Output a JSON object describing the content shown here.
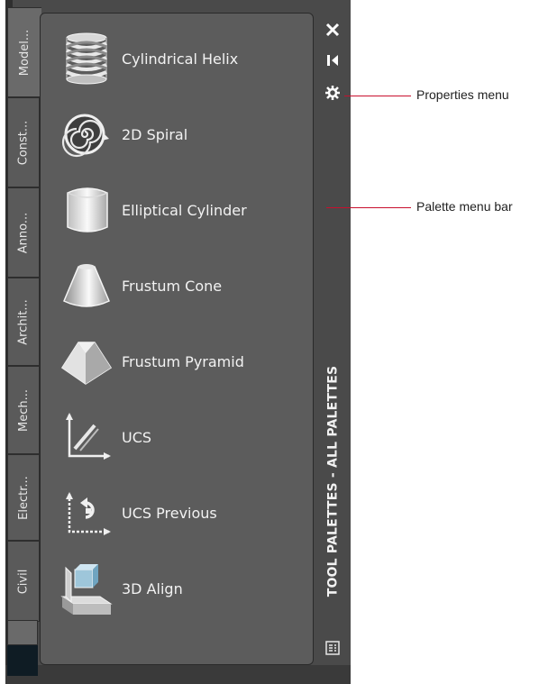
{
  "tabs": [
    {
      "label": "Model..."
    },
    {
      "label": "Const..."
    },
    {
      "label": "Anno..."
    },
    {
      "label": "Archit..."
    },
    {
      "label": "Mech..."
    },
    {
      "label": "Electr..."
    },
    {
      "label": "Civil"
    }
  ],
  "tools": [
    {
      "label": "Cylindrical Helix",
      "icon": "helix-icon"
    },
    {
      "label": "2D Spiral",
      "icon": "spiral-icon"
    },
    {
      "label": "Elliptical Cylinder",
      "icon": "cylinder-icon"
    },
    {
      "label": "Frustum Cone",
      "icon": "cone-icon"
    },
    {
      "label": "Frustum Pyramid",
      "icon": "pyramid-icon"
    },
    {
      "label": "UCS",
      "icon": "ucs-icon"
    },
    {
      "label": "UCS Previous",
      "icon": "ucs-previous-icon"
    },
    {
      "label": "3D Align",
      "icon": "align-3d-icon"
    }
  ],
  "palette_title": "TOOL PALETTES - ALL PALETTES",
  "callouts": {
    "properties": "Properties menu",
    "menubar": "Palette menu bar"
  },
  "colors": {
    "accent_line": "#c8102e",
    "panel": "#5c5c5c",
    "frame": "#4a4a4a"
  }
}
